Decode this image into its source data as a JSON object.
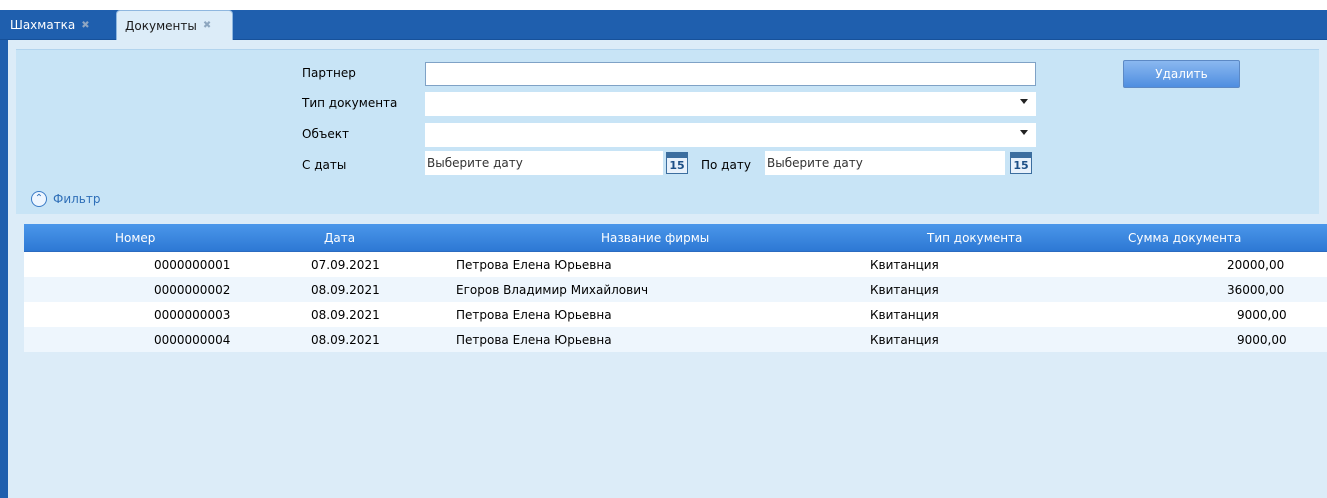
{
  "tabs": [
    {
      "label": "Шахматка",
      "close_icon": "close-icon"
    },
    {
      "label": "Документы",
      "close_icon": "close-icon"
    }
  ],
  "filter": {
    "partner_label": "Партнер",
    "partner_value": "",
    "doc_type_label": "Тип документа",
    "doc_type_value": "",
    "object_label": "Объект",
    "object_value": "",
    "from_label": "С даты",
    "from_placeholder": "Выберите дату",
    "to_label": "По дату",
    "to_placeholder": "Выберите дату",
    "calendar_day": "15",
    "toggle_label": "Фильтр"
  },
  "actions": {
    "delete_label": "Удалить"
  },
  "table": {
    "columns": [
      "Номер",
      "Дата",
      "Название фирмы",
      "Тип документа",
      "Сумма документа"
    ],
    "rows": [
      [
        "0000000001",
        "07.09.2021",
        "Петрова Елена Юрьевна",
        "Квитанция",
        "20000,00"
      ],
      [
        "0000000002",
        "08.09.2021",
        "Егоров Владимир Михайлович",
        "Квитанция",
        "36000,00"
      ],
      [
        "0000000003",
        "08.09.2021",
        "Петрова Елена Юрьевна",
        "Квитанция",
        "9000,00"
      ],
      [
        "0000000004",
        "08.09.2021",
        "Петрова Елена Юрьевна",
        "Квитанция",
        "9000,00"
      ]
    ]
  },
  "colors": {
    "tabstrip": "#1f5fae",
    "panel": "#c8e4f6",
    "header": "#3a86df",
    "accent": "#2f6fb8"
  }
}
